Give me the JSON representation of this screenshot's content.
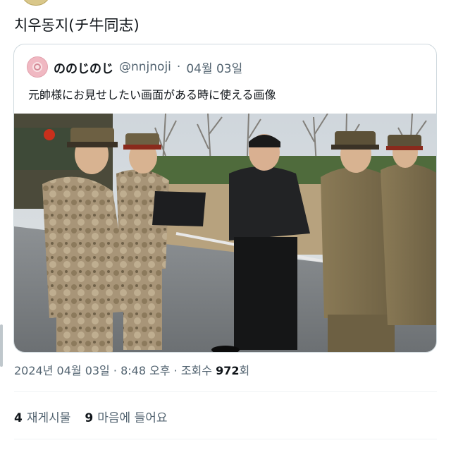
{
  "post": {
    "text": "치우동지(チ牛同志)"
  },
  "quote": {
    "name": "ののじのじ",
    "handle": "@nnjnoji",
    "separator": "·",
    "date": "04월 03일",
    "text": "元帥様にお見せしたい画面がある時に使える画像"
  },
  "meta": {
    "date": "2024년 04월 03일",
    "time": "8:48 오후",
    "separator": "·",
    "views_label": "조회수",
    "views_count": "972",
    "views_suffix": "회"
  },
  "stats": {
    "retweets_count": "4",
    "retweets_label": "재게시물",
    "likes_count": "9",
    "likes_label": "마음에 들어요"
  },
  "colors": {
    "text": "#0f1419",
    "secondary": "#536471",
    "border": "#cfd9de"
  }
}
